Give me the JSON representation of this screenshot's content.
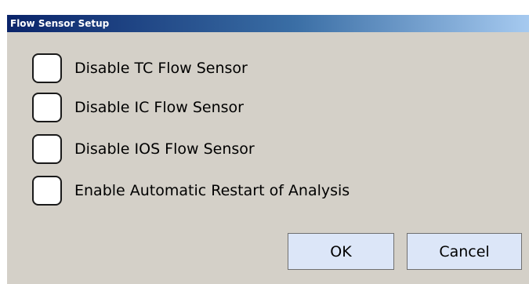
{
  "window": {
    "title": "Flow Sensor Setup"
  },
  "options": [
    {
      "label": "Disable TC Flow Sensor",
      "checked": false
    },
    {
      "label": "Disable IC Flow Sensor",
      "checked": false
    },
    {
      "label": "Disable IOS Flow Sensor",
      "checked": false
    },
    {
      "label": "Enable Automatic Restart of Analysis",
      "checked": false
    }
  ],
  "buttons": {
    "ok_label": "OK",
    "cancel_label": "Cancel"
  },
  "colors": {
    "dialog_background": "#d4d0c8",
    "titlebar_start": "#0a246a",
    "titlebar_end": "#a6caf0",
    "button_background": "#dce6f8"
  }
}
